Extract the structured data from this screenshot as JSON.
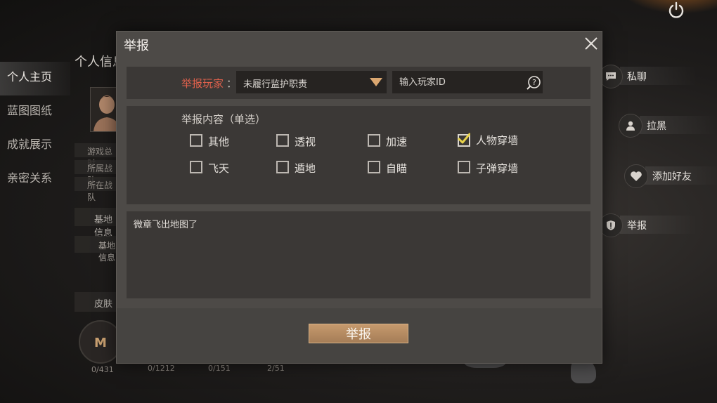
{
  "background": {
    "left_nav": [
      "个人主页",
      "蓝图图纸",
      "成就展示",
      "亲密关系"
    ],
    "section_title": "个人信息",
    "base_title": "基地信息",
    "base_row": "基地信息",
    "skin_title": "皮肤",
    "info_rows": [
      "游戏总时",
      "所属战队",
      "所在战队"
    ],
    "counts": [
      "0/431",
      "0/1212",
      "0/151",
      "2/51"
    ],
    "right_actions": [
      {
        "label": "私聊",
        "icon": "chat-icon"
      },
      {
        "label": "拉黑",
        "icon": "block-user-icon"
      },
      {
        "label": "添加好友",
        "icon": "add-friend-heart-icon"
      },
      {
        "label": "举报",
        "icon": "shield-report-icon"
      }
    ]
  },
  "modal": {
    "title": "举报",
    "report_player_label": "举报玩家",
    "colon": "：",
    "reason_selected": "未履行监护职责",
    "player_id_placeholder": "输入玩家ID",
    "content_label": "举报内容（单选）",
    "options": [
      {
        "label": "其他",
        "checked": false
      },
      {
        "label": "透视",
        "checked": false
      },
      {
        "label": "加速",
        "checked": false
      },
      {
        "label": "人物穿墙",
        "checked": true
      },
      {
        "label": "飞天",
        "checked": false
      },
      {
        "label": "遁地",
        "checked": false
      },
      {
        "label": "自瞄",
        "checked": false
      },
      {
        "label": "子弹穿墙",
        "checked": false
      }
    ],
    "description": "微章飞出地图了",
    "submit_label": "举报"
  },
  "colors": {
    "accent_red": "#e0614c",
    "button_gold": "#b98e63",
    "check_yellow": "#e8d24a"
  }
}
